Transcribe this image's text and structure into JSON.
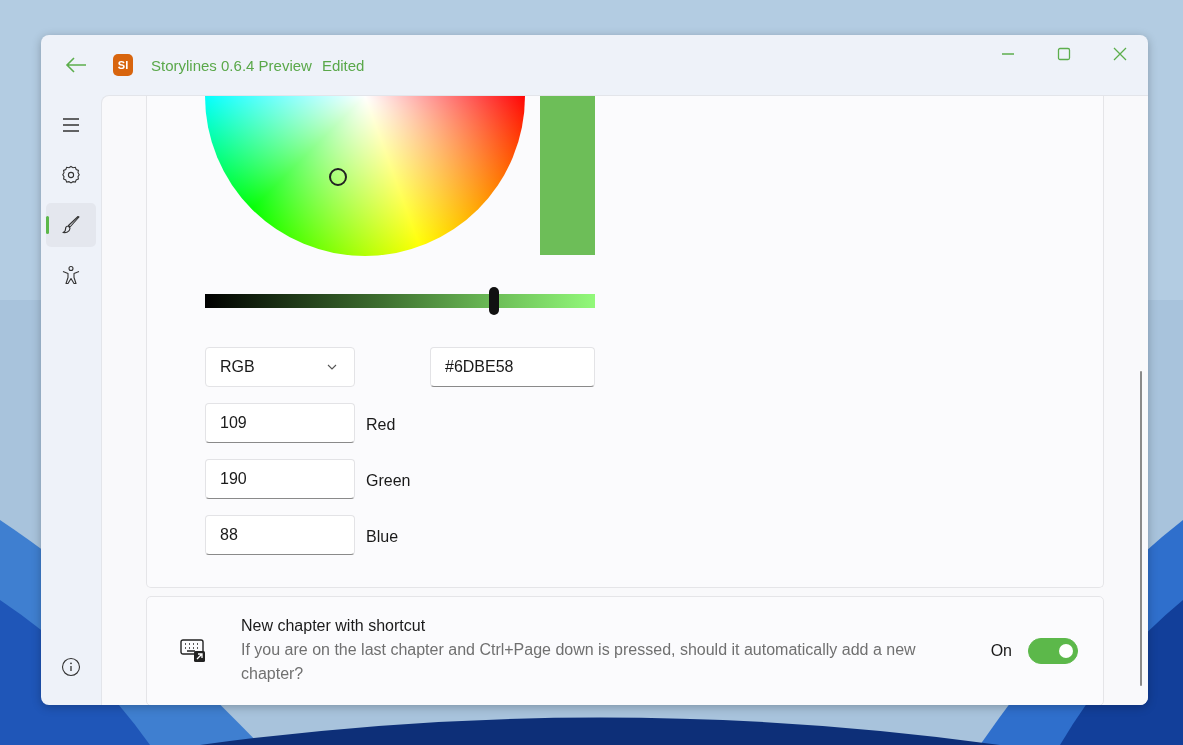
{
  "window": {
    "title": "Storylines 0.6.4 Preview",
    "status": "Edited",
    "app_badge": "SI"
  },
  "nav": {
    "items": [
      {
        "kind": "menu",
        "selected": false
      },
      {
        "kind": "settings",
        "selected": false
      },
      {
        "kind": "brush",
        "selected": true
      },
      {
        "kind": "accessibility",
        "selected": false
      }
    ],
    "footer": [
      {
        "kind": "info",
        "selected": false
      }
    ]
  },
  "color_picker": {
    "brightness": {
      "level": 0.74
    },
    "mode": "RGB",
    "hex": "#6DBE58",
    "channels": [
      {
        "value": "109",
        "label": "Red"
      },
      {
        "value": "190",
        "label": "Green"
      },
      {
        "value": "88",
        "label": "Blue"
      }
    ]
  },
  "setting": {
    "title": "New chapter with shortcut",
    "description": "If you are on the last chapter and Ctrl+Page down is pressed, should it automatically add a new chapter?",
    "state_text": "On",
    "on": true
  }
}
